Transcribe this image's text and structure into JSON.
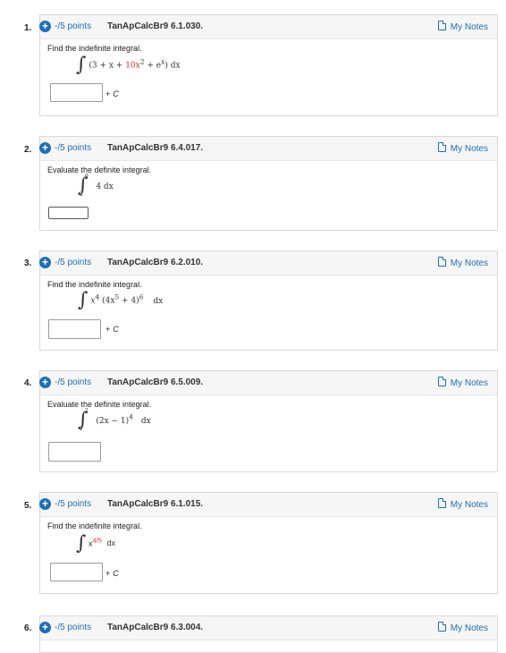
{
  "common": {
    "points": "-/5 points",
    "notes_label": "My Notes",
    "plus_c": "+ C",
    "c_letter": "C"
  },
  "questions": [
    {
      "number": "1.",
      "id": "TanApCalcBr9 6.1.030.",
      "prompt": "Find the indefinite integral.",
      "expr_open": "(3 + x + ",
      "expr_red": "10x",
      "expr_exp": "2",
      "expr_rest": " + e",
      "expr_exp2": "x",
      "expr_close": ") dx"
    },
    {
      "number": "2.",
      "id": "TanApCalcBr9 6.4.017.",
      "prompt": "Evaluate the definite integral.",
      "upper": "9",
      "lower": "2",
      "integrand": "4 dx"
    },
    {
      "number": "3.",
      "id": "TanApCalcBr9 6.2.010.",
      "prompt": "Find the indefinite integral.",
      "integrand_a": "x",
      "integrand_a_exp": "4",
      "integrand_b": "(4x",
      "integrand_b_exp": "5",
      "integrand_c": " + 4)",
      "integrand_c_exp": "6",
      "integrand_d": "dx"
    },
    {
      "number": "4.",
      "id": "TanApCalcBr9 6.5.009.",
      "prompt": "Evaluate the definite integral.",
      "upper": "2",
      "lower": "1",
      "integrand_a": "(2x − 1)",
      "integrand_a_exp": "4",
      "integrand_b": "dx"
    },
    {
      "number": "5.",
      "id": "TanApCalcBr9 6.1.015.",
      "prompt": "Find the indefinite integral.",
      "base": "x",
      "exp": "4/5",
      "dx": "dx"
    },
    {
      "number": "6.",
      "id": "TanApCalcBr9 6.3.004.",
      "points": "-/5 points"
    }
  ]
}
